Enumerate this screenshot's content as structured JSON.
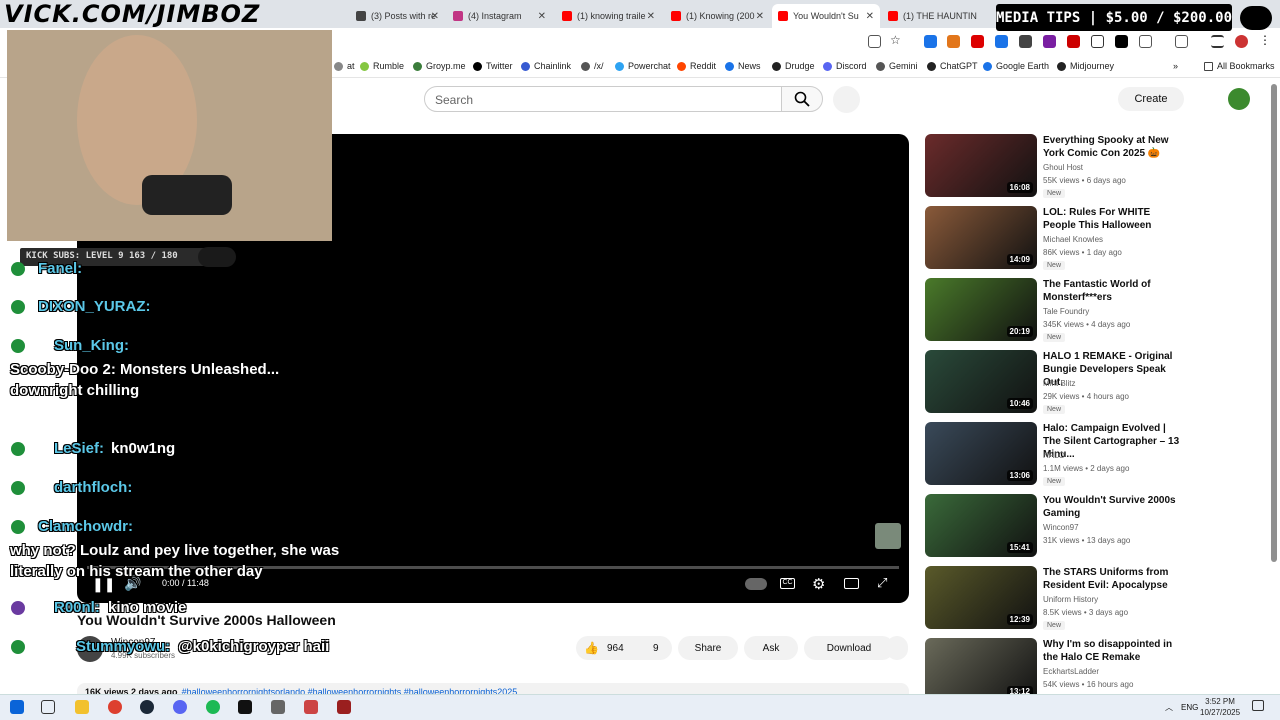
{
  "overlay": {
    "url_text": "VICK.COM/JIMBOZ",
    "media_tips": "MEDIA TIPS | $5.00 / $200.00",
    "kick_subs": "KICK SUBS: LEVEL 9 163 / 180"
  },
  "tabs": [
    {
      "label": "(3) Posts with re",
      "color": "#444"
    },
    {
      "label": "(4) Instagram",
      "color": "#c13584"
    },
    {
      "label": "(1) knowing traile",
      "color": "#ff0000"
    },
    {
      "label": "(1) Knowing (200",
      "color": "#ff0000"
    },
    {
      "label": "You Wouldn't Su",
      "color": "#ff0000"
    },
    {
      "label": "(1) THE HAUNTIN",
      "color": "#ff0000"
    }
  ],
  "bookmarks": [
    {
      "label": "at",
      "color": "#888"
    },
    {
      "label": "Rumble",
      "color": "#85c742"
    },
    {
      "label": "Groyp.me",
      "color": "#3b7d3b"
    },
    {
      "label": "Twitter",
      "color": "#000"
    },
    {
      "label": "Chainlink",
      "color": "#375bd2"
    },
    {
      "label": "/x/",
      "color": "#555"
    },
    {
      "label": "Powerchat",
      "color": "#2ea3f2"
    },
    {
      "label": "Reddit",
      "color": "#ff4500"
    },
    {
      "label": "News",
      "color": "#1a73e8"
    },
    {
      "label": "Drudge",
      "color": "#222"
    },
    {
      "label": "Discord",
      "color": "#5865f2"
    },
    {
      "label": "Gemini",
      "color": "#555"
    },
    {
      "label": "ChatGPT",
      "color": "#222"
    },
    {
      "label": "Google Earth",
      "color": "#1a73e8"
    },
    {
      "label": "Midjourney",
      "color": "#222"
    }
  ],
  "all_bookmarks": "All Bookmarks",
  "search": {
    "placeholder": "Search"
  },
  "create_label": "Create",
  "video": {
    "time": "0:00 / 11:48",
    "title": "You Wouldn't Survive 2000s Halloween",
    "channel": "Wincon97",
    "subscribers": "4.99K subscribers",
    "likes": "964",
    "dislikes": "9",
    "share": "Share",
    "ask": "Ask",
    "download": "Download",
    "desc_stats": "16K views  2 days ago",
    "desc_tags": "#halloweenhorrornightsorlando #halloweenhorrornights #halloweenhorrornights2025"
  },
  "recommendations": [
    {
      "title": "Everything Spooky at New York Comic Con 2025 🎃",
      "channel": "Ghoul Host",
      "meta": "55K views • 6 days ago",
      "duration": "16:08",
      "new": "New",
      "thumb": "#6b2b2b"
    },
    {
      "title": "LOL: Rules For WHITE People This Halloween",
      "channel": "Michael Knowles",
      "meta": "86K views • 1 day ago",
      "duration": "14:09",
      "new": "New",
      "thumb": "#8a5a3a"
    },
    {
      "title": "The Fantastic World of Monsterf***ers",
      "channel": "Tale Foundry",
      "meta": "345K views • 4 days ago",
      "duration": "20:19",
      "new": "New",
      "thumb": "#4a7a2a"
    },
    {
      "title": "HALO 1 REMAKE - Original Bungie Developers Speak Out.",
      "channel": "Mint Blitz",
      "meta": "29K views • 4 hours ago",
      "duration": "10:46",
      "new": "New",
      "thumb": "#2a4a3a"
    },
    {
      "title": "Halo: Campaign Evolved | The Silent Cartographer – 13 Minu...",
      "channel": "HALO",
      "meta": "1.1M views • 2 days ago",
      "duration": "13:06",
      "new": "New",
      "thumb": "#3a4a5a"
    },
    {
      "title": "You Wouldn't Survive 2000s Gaming",
      "channel": "Wincon97",
      "meta": "31K views • 13 days ago",
      "duration": "15:41",
      "new": "",
      "thumb": "#3a6a3a"
    },
    {
      "title": "The STARS Uniforms from Resident Evil: Apocalypse",
      "channel": "Uniform History",
      "meta": "8.5K views • 3 days ago",
      "duration": "12:39",
      "new": "New",
      "thumb": "#5a5a2a"
    },
    {
      "title": "Why I'm so disappointed in the Halo CE Remake",
      "channel": "EckhartsLadder",
      "meta": "54K views • 16 hours ago",
      "duration": "13:12",
      "new": "",
      "thumb": "#6a6a5a"
    }
  ],
  "chat": [
    {
      "user": "Fanel:",
      "msg": ""
    },
    {
      "user": "DIXON_YURAZ:",
      "msg": ""
    },
    {
      "user": "Sun_King:",
      "msg": ""
    },
    {
      "user": "",
      "msg": "Scooby-Doo 2: Monsters Unleashed..."
    },
    {
      "user": "",
      "msg": "downright chilling"
    },
    {
      "user": "LeSief:",
      "msg": "kn0w1ng"
    },
    {
      "user": "darthfloch:",
      "msg": ""
    },
    {
      "user": "Clamchowdr:",
      "msg": ""
    },
    {
      "user": "",
      "msg": "why not? Loulz and pey live together, she was"
    },
    {
      "user": "",
      "msg": "literally on his stream the other day"
    },
    {
      "user": "R00nl:",
      "msg": "kino movie"
    },
    {
      "user": "Stummyowu:",
      "msg": "@k0kichigroyper haii"
    }
  ],
  "taskbar": {
    "lang": "ENG",
    "time": "3:52 PM",
    "date": "10/27/2025"
  }
}
